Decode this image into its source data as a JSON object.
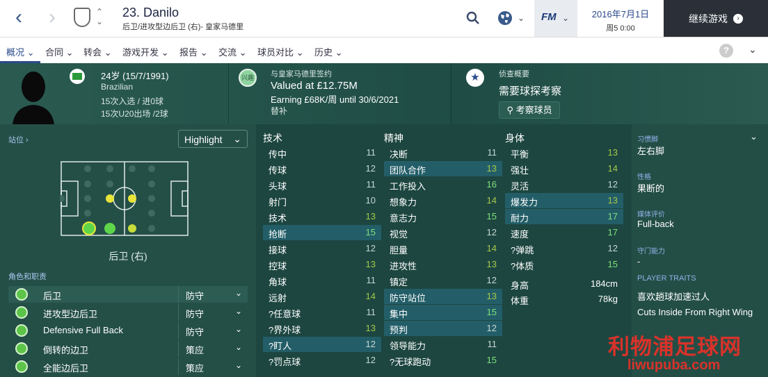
{
  "header": {
    "player_name": "23. Danilo",
    "position": "后卫/进攻型边后卫 (右)- 皇家马德里",
    "date": "2016年7月1日",
    "day_time": "周5 0:00",
    "continue_label": "继续游戏",
    "fm_label": "FM"
  },
  "tabs": [
    "概况",
    "合同",
    "转会",
    "游戏开发",
    "报告",
    "交流",
    "球员对比",
    "历史"
  ],
  "profile": {
    "age": "24岁 (15/7/1991)",
    "nationality": "Brazilian",
    "caps": "15次入选 / 进0球",
    "u20": "15次U20出场 /2球",
    "happy": "兴趣",
    "contract_header": "与皇家马德里签约",
    "value": "Valued at £12.75M",
    "earning": "Earning £68K/周 until 30/6/2021",
    "status": "替补",
    "scout_header": "侦查概要",
    "scout_text": "需要球探考察",
    "scout_button": "考察球员"
  },
  "left_panel": {
    "position_link": "站位 ›",
    "dropdown": "Highlight",
    "position_label": "后卫 (右)",
    "roles_title": "角色和职责",
    "roles": [
      {
        "name": "后卫",
        "duty": "防守"
      },
      {
        "name": "进攻型边后卫",
        "duty": "防守"
      },
      {
        "name": "Defensive Full Back",
        "duty": "防守"
      },
      {
        "name": "倒转的边卫",
        "duty": "策应"
      },
      {
        "name": "全能边后卫",
        "duty": "策应"
      }
    ]
  },
  "attributes": {
    "technical_title": "技术",
    "mental_title": "精神",
    "physical_title": "身体",
    "technical": [
      {
        "name": "传中",
        "value": "11"
      },
      {
        "name": "传球",
        "value": "12"
      },
      {
        "name": "头球",
        "value": "11"
      },
      {
        "name": "射门",
        "value": "10"
      },
      {
        "name": "技术",
        "value": "13"
      },
      {
        "name": "抢断",
        "value": "15"
      },
      {
        "name": "接球",
        "value": "12"
      },
      {
        "name": "控球",
        "value": "13"
      },
      {
        "name": "角球",
        "value": "11"
      },
      {
        "name": "远射",
        "value": "14"
      },
      {
        "name": "?任意球",
        "value": "11"
      },
      {
        "name": "?界外球",
        "value": "13"
      },
      {
        "name": "?盯人",
        "value": "12"
      },
      {
        "name": "?罚点球",
        "value": "12"
      }
    ],
    "mental": [
      {
        "name": "决断",
        "value": "11"
      },
      {
        "name": "团队合作",
        "value": "13"
      },
      {
        "name": "工作投入",
        "value": "16"
      },
      {
        "name": "想象力",
        "value": "14"
      },
      {
        "name": "意志力",
        "value": "15"
      },
      {
        "name": "视觉",
        "value": "12"
      },
      {
        "name": "胆量",
        "value": "14"
      },
      {
        "name": "进攻性",
        "value": "13"
      },
      {
        "name": "镇定",
        "value": "12"
      },
      {
        "name": "防守站位",
        "value": "13"
      },
      {
        "name": "集中",
        "value": "15"
      },
      {
        "name": "预判",
        "value": "12"
      },
      {
        "name": "领导能力",
        "value": "11"
      },
      {
        "name": "?无球跑动",
        "value": "15"
      }
    ],
    "physical": [
      {
        "name": "平衡",
        "value": "13"
      },
      {
        "name": "强壮",
        "value": "14"
      },
      {
        "name": "灵活",
        "value": "12"
      },
      {
        "name": "爆发力",
        "value": "13"
      },
      {
        "name": "耐力",
        "value": "17"
      },
      {
        "name": "速度",
        "value": "17"
      },
      {
        "name": "?弹跳",
        "value": "12"
      },
      {
        "name": "?体质",
        "value": "15"
      }
    ],
    "height_label": "身高",
    "height": "184cm",
    "weight_label": "体重",
    "weight": "78kg"
  },
  "right_panel": {
    "foot_label": "习惯脚",
    "foot": "左右脚",
    "personality_label": "性格",
    "personality": "果断的",
    "media_label": "媒体评价",
    "media": "Full-back",
    "gk_label": "守门能力",
    "gk": "-",
    "traits_label": "PLAYER TRAITS",
    "trait1": "喜欢趟球加速过人",
    "trait2": "Cuts Inside From Right Wing"
  },
  "watermark": {
    "line1": "利物浦足球网",
    "line2": "liwupuba.com"
  },
  "colors": {
    "accent": "#2a4a8c",
    "high": "#7ee07a",
    "mid": "#a6c84a",
    "panel": "#1d4640"
  }
}
